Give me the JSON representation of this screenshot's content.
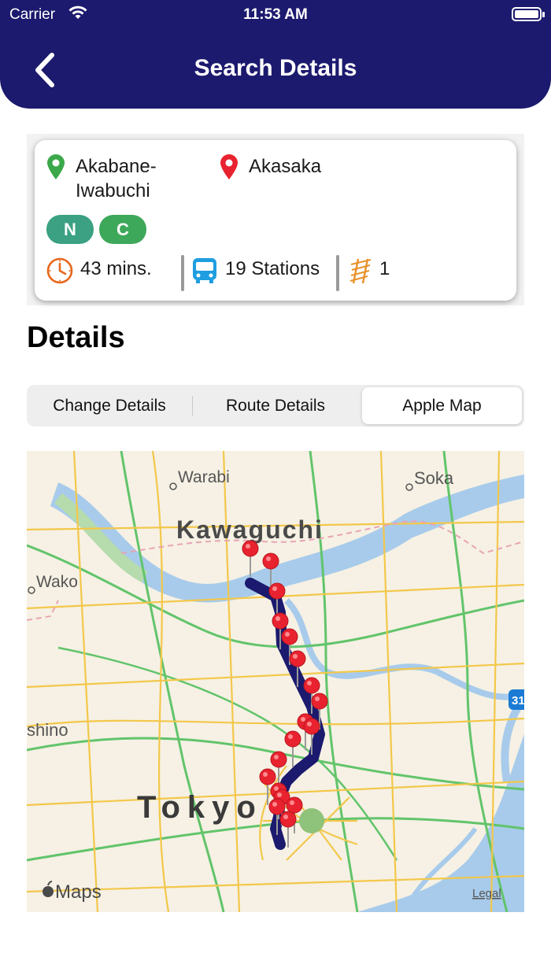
{
  "status_bar": {
    "carrier": "Carrier",
    "time": "11:53 AM"
  },
  "header": {
    "title": "Search Details"
  },
  "route": {
    "origin": "Akabane-\nIwabuchi",
    "destination": "Akasaka",
    "lines": [
      {
        "label": "N",
        "color": "#3ba182"
      },
      {
        "label": "C",
        "color": "#3ea85a"
      }
    ],
    "duration": "43 mins.",
    "stations": "19 Stations",
    "transfers": "1"
  },
  "section_title": "Details",
  "tabs": [
    {
      "label": "Change Details"
    },
    {
      "label": "Route Details"
    },
    {
      "label": "Apple Map",
      "active": true
    }
  ],
  "map": {
    "labels": [
      "Warabi",
      "Soka",
      "Kawaguchi",
      "Wako",
      "shino",
      "Tokyo"
    ],
    "attribution": "Maps",
    "legal": "Legal",
    "route_shield": "31"
  },
  "colors": {
    "header": "#1c1a6e",
    "origin_pin": "#3ba94a",
    "destination_pin": "#e8232f",
    "route_line": "#1c1a6e",
    "clock_icon": "#e8671b",
    "bus_icon": "#1e9ee0",
    "ladder_icon": "#e8922a"
  }
}
